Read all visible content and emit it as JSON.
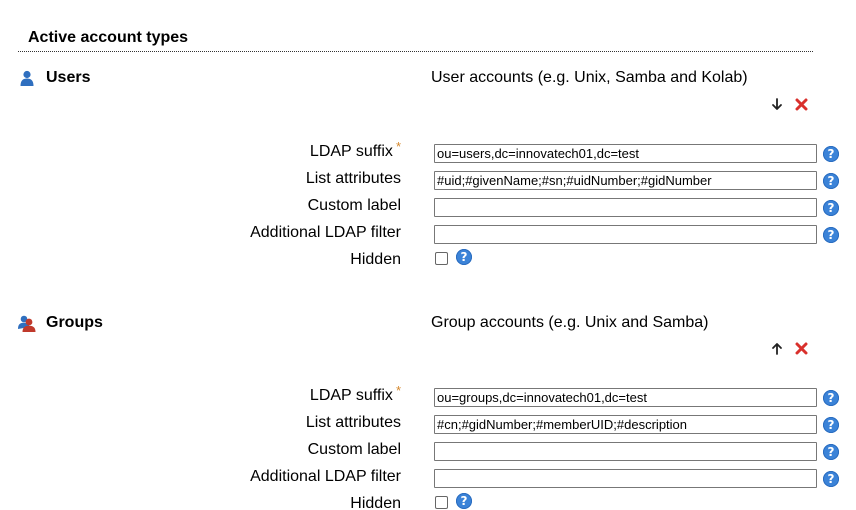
{
  "section_title": "Active account types",
  "types": [
    {
      "name": "Users",
      "description": "User accounts (e.g. Unix, Samba and Kolab)",
      "icon": "user-icon",
      "fields": {
        "ldap_suffix_label": "LDAP suffix",
        "ldap_suffix_required": "*",
        "ldap_suffix_value": "ou=users,dc=innovatech01,dc=test",
        "list_attributes_label": "List attributes",
        "list_attributes_value": "#uid;#givenName;#sn;#uidNumber;#gidNumber",
        "custom_label_label": "Custom label",
        "custom_label_value": "",
        "additional_filter_label": "Additional LDAP filter",
        "additional_filter_value": "",
        "hidden_label": "Hidden",
        "hidden_checked": false
      }
    },
    {
      "name": "Groups",
      "description": "Group accounts (e.g. Unix and Samba)",
      "icon": "group-icon",
      "fields": {
        "ldap_suffix_label": "LDAP suffix",
        "ldap_suffix_required": "*",
        "ldap_suffix_value": "ou=groups,dc=innovatech01,dc=test",
        "list_attributes_label": "List attributes",
        "list_attributes_value": "#cn;#gidNumber;#memberUID;#description",
        "custom_label_label": "Custom label",
        "custom_label_value": "",
        "additional_filter_label": "Additional LDAP filter",
        "additional_filter_value": "",
        "hidden_label": "Hidden",
        "hidden_checked": false
      }
    }
  ],
  "help_glyph": "?",
  "colors": {
    "help_bg": "#3b83d8",
    "remove": "#d9302c",
    "required": "#d4872c",
    "user_icon": "#2f6fbf",
    "group_icon_front": "#c0392b"
  }
}
